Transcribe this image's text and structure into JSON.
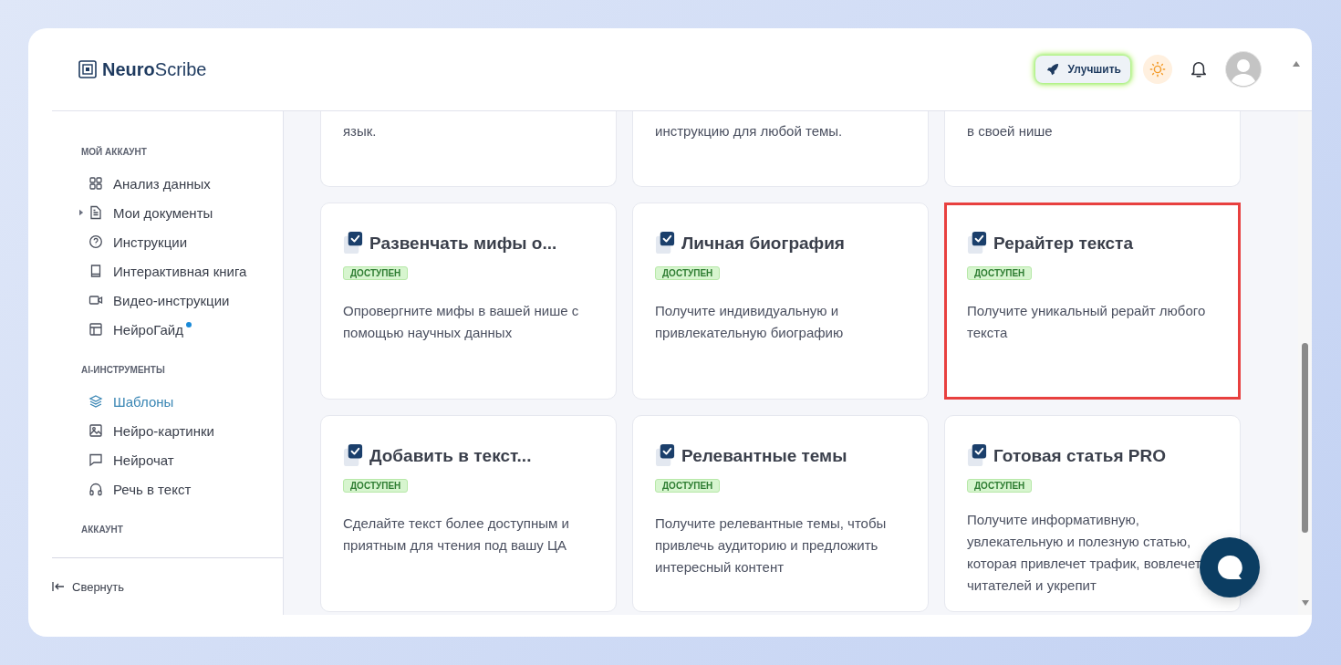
{
  "header": {
    "logo_bold": "Neuro",
    "logo_regular": "Scribe",
    "upgrade_button": "Улучшить"
  },
  "sidebar": {
    "sections": [
      {
        "label": "МОЙ АККАУНТ",
        "items": [
          {
            "label": "Анализ данных",
            "kind": "link",
            "selected": false,
            "dot": false
          },
          {
            "label": "Мои документы",
            "kind": "group",
            "selected": false,
            "dot": false
          },
          {
            "label": "Инструкции",
            "kind": "link",
            "selected": false,
            "dot": false
          },
          {
            "label": "Интерактивная книга",
            "kind": "link",
            "selected": false,
            "dot": false
          },
          {
            "label": "Видео-инструкции",
            "kind": "link",
            "selected": false,
            "dot": false
          },
          {
            "label": "НейроГайд",
            "kind": "link",
            "selected": false,
            "dot": true
          }
        ]
      },
      {
        "label": "AI-ИНСТРУМЕНТЫ",
        "items": [
          {
            "label": "Шаблоны",
            "kind": "link",
            "selected": true,
            "dot": false
          },
          {
            "label": "Нейро-картинки",
            "kind": "link",
            "selected": false,
            "dot": false
          },
          {
            "label": "Нейрочат",
            "kind": "link",
            "selected": false,
            "dot": false
          },
          {
            "label": "Речь в текст",
            "kind": "link",
            "selected": false,
            "dot": false
          }
        ]
      },
      {
        "label": "АККАУНТ"
      }
    ],
    "collapse": "Свернуть"
  },
  "cards": [
    {
      "kind": "partial",
      "description": "язык.",
      "highlighted": false
    },
    {
      "kind": "partial",
      "description": "инструкцию для любой темы.",
      "highlighted": false
    },
    {
      "kind": "partial",
      "description": "в своей нише",
      "highlighted": false
    },
    {
      "kind": "full",
      "title": "Развенчать мифы о...",
      "badge": "ДОСТУПЕН",
      "description": "Опровергните мифы в вашей нише с помощью научных данных",
      "highlighted": false
    },
    {
      "kind": "full",
      "title": "Личная биография",
      "badge": "ДОСТУПЕН",
      "description": "Получите индивидуальную и привлекательную биографию",
      "highlighted": false
    },
    {
      "kind": "full",
      "title": "Рерайтер текста",
      "badge": "ДОСТУПЕН",
      "description": "Получите уникальный рерайт любого текста",
      "highlighted": true
    },
    {
      "kind": "full",
      "title": "Добавить в текст...",
      "badge": "ДОСТУПЕН",
      "description": "Сделайте текст более доступным и приятным для чтения под вашу ЦА",
      "highlighted": false
    },
    {
      "kind": "full",
      "title": "Релевантные темы",
      "badge": "ДОСТУПЕН",
      "description": "Получите релевантные темы, чтобы привлечь аудиторию и предложить интересный контент",
      "highlighted": false
    },
    {
      "kind": "full",
      "title": "Готовая статья PRO",
      "badge": "ДОСТУПЕН",
      "description": "Получите информативную, увлекательную и полезную статью, которая привлечет трафик, вовлечет читателей и укрепит",
      "highlighted": false
    }
  ]
}
